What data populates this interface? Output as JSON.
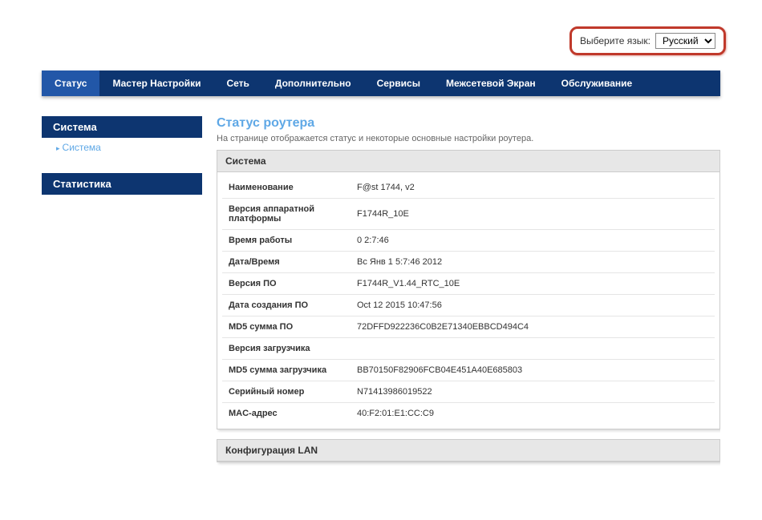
{
  "language": {
    "label": "Выберите язык:",
    "selected": "Русский"
  },
  "nav": {
    "items": [
      "Статус",
      "Мастер Настройки",
      "Сеть",
      "Дополнительно",
      "Сервисы",
      "Межсетевой Экран",
      "Обслуживание"
    ]
  },
  "sidebar": {
    "group1": {
      "title": "Система",
      "link": "Система"
    },
    "group2": {
      "title": "Статистика"
    }
  },
  "page": {
    "title": "Статус роутера",
    "desc": "На странице отображается статус и некоторые основные настройки роутера."
  },
  "system": {
    "heading": "Система",
    "rows": [
      {
        "k": "Наименование",
        "v": "F@st 1744, v2"
      },
      {
        "k": "Версия аппаратной платформы",
        "v": "F1744R_10E"
      },
      {
        "k": "Время работы",
        "v": "0 2:7:46"
      },
      {
        "k": "Дата/Время",
        "v": "Вс Янв 1 5:7:46 2012"
      },
      {
        "k": "Версия ПО",
        "v": "F1744R_V1.44_RTC_10E"
      },
      {
        "k": "Дата создания ПО",
        "v": "Oct 12 2015 10:47:56"
      },
      {
        "k": "MD5 сумма ПО",
        "v": "72DFFD922236C0B2E71340EBBCD494C4"
      },
      {
        "k": "Версия загрузчика",
        "v": ""
      },
      {
        "k": "MD5 сумма загрузчика",
        "v": "BB70150F82906FCB04E451A40E685803"
      },
      {
        "k": "Серийный номер",
        "v": "N71413986019522"
      },
      {
        "k": "MAC-адрес",
        "v": "40:F2:01:E1:CC:C9"
      }
    ]
  },
  "lan": {
    "heading": "Конфигурация LAN"
  }
}
